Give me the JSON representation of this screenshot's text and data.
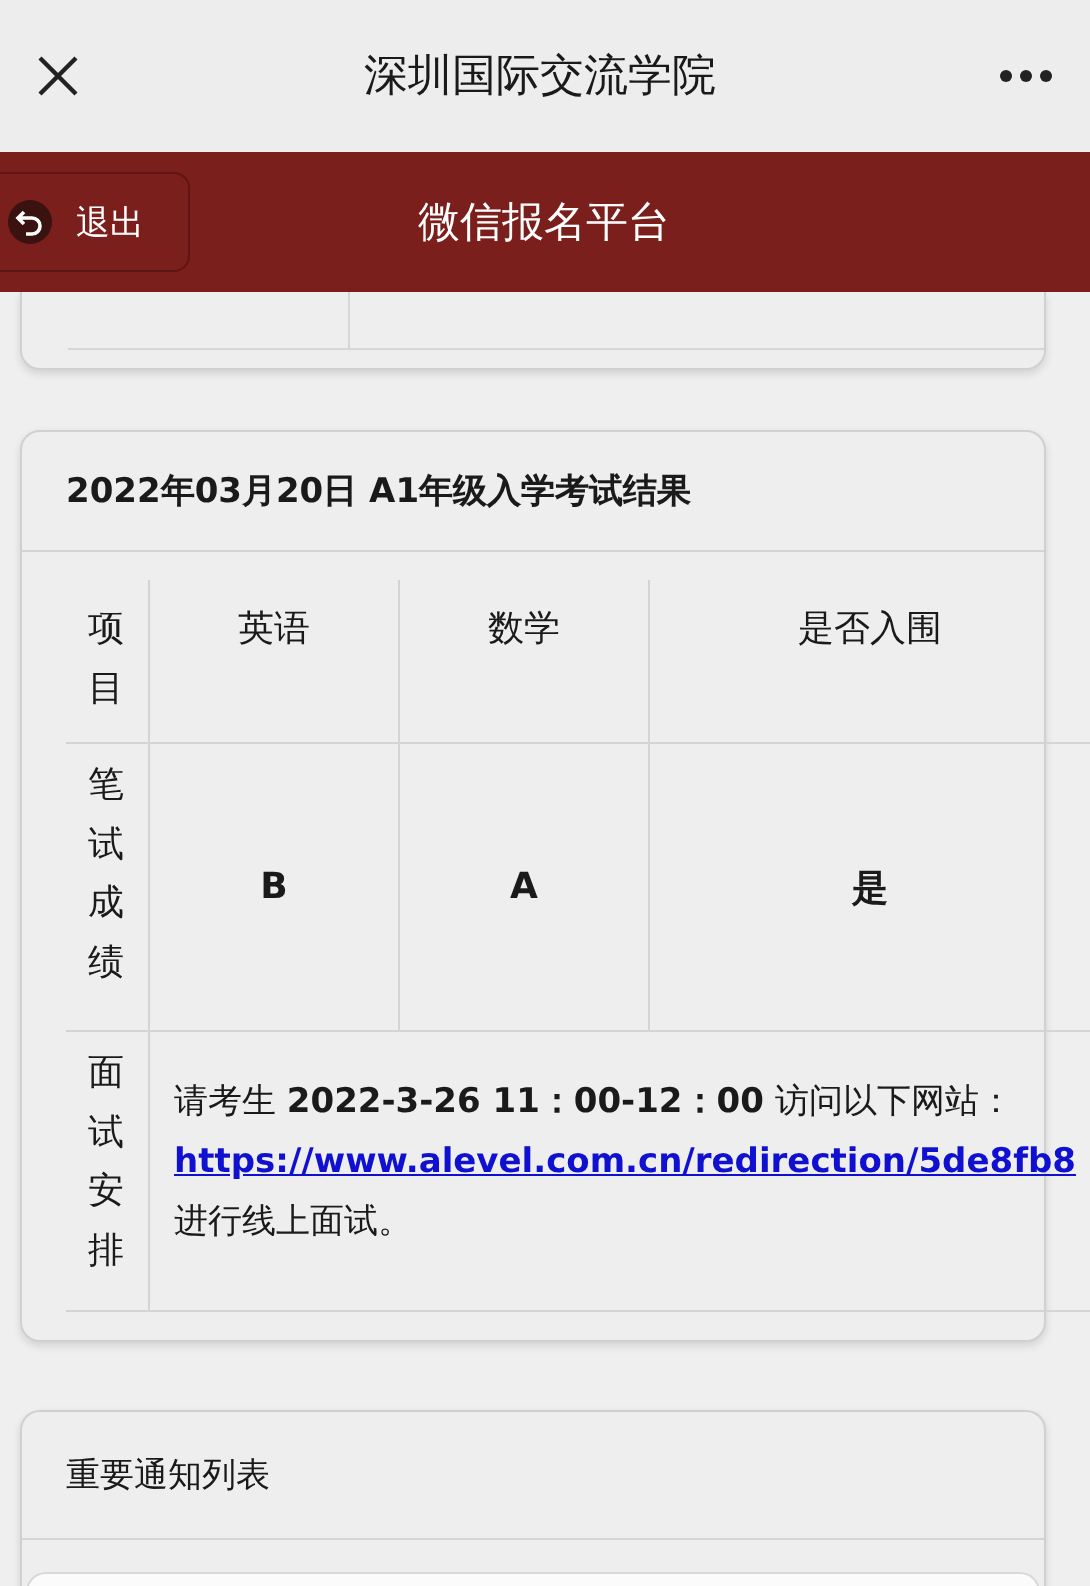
{
  "window": {
    "title": "深圳国际交流学院"
  },
  "header": {
    "back_label": "退出",
    "title": "微信报名平台"
  },
  "result_card": {
    "title": "2022年03月20日 A1年级入学考试结果",
    "columns": [
      "项目",
      "英语",
      "数学",
      "是否入围"
    ],
    "rows": [
      {
        "kind": "scores",
        "label": "笔试成绩",
        "cells": [
          "B",
          "A",
          "是"
        ]
      },
      {
        "kind": "note",
        "label": "面试安排",
        "text": "请考生 **2022-3-26 11：00-12：00** 访问以下网站：",
        "link": "https://www.alevel.com.cn/redirection/5de8fb8",
        "text_after": "进行线上面试。"
      }
    ]
  },
  "notice_card": {
    "title": "重要通知列表"
  }
}
